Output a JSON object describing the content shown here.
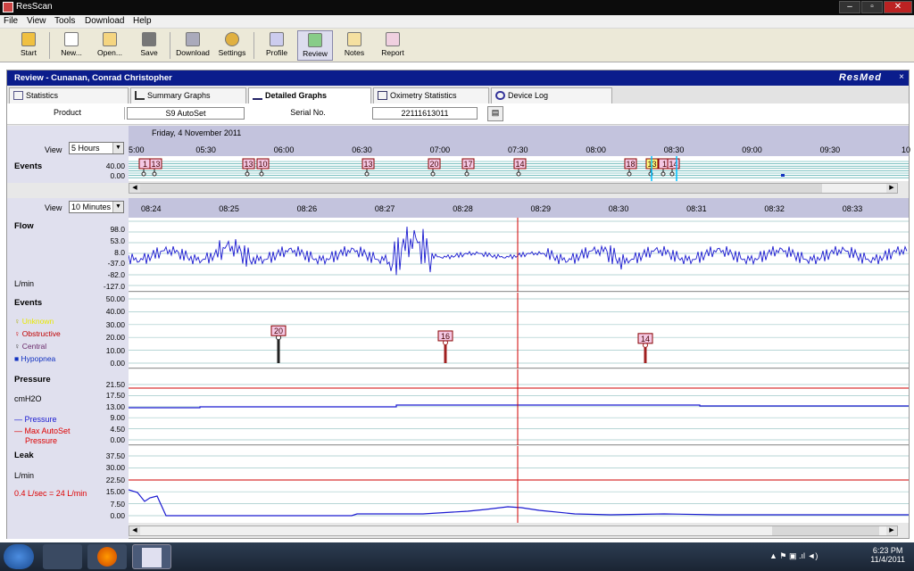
{
  "window": {
    "title": "ResScan"
  },
  "menu": [
    "File",
    "View",
    "Tools",
    "Download",
    "Help"
  ],
  "toolbar": [
    {
      "label": "Start",
      "icon": "start-icon"
    },
    {
      "label": "New...",
      "icon": "new-icon"
    },
    {
      "label": "Open...",
      "icon": "open-icon"
    },
    {
      "label": "Save",
      "icon": "save-icon"
    },
    {
      "label": "Download",
      "icon": "download-icon"
    },
    {
      "label": "Settings",
      "icon": "settings-icon"
    },
    {
      "label": "Profile",
      "icon": "profile-icon"
    },
    {
      "label": "Review",
      "icon": "review-icon"
    },
    {
      "label": "Notes",
      "icon": "notes-icon"
    },
    {
      "label": "Report",
      "icon": "report-icon"
    }
  ],
  "review": {
    "title": "Review - Cunanan, Conrad Christopher",
    "brand": "ResMed",
    "close": "×"
  },
  "tabs": [
    "Statistics",
    "Summary Graphs",
    "Detailed Graphs",
    "Oximetry Statistics",
    "Device Log"
  ],
  "product": {
    "product_label": "Product",
    "product_value": "S9 AutoSet",
    "serial_label": "Serial No.",
    "serial_value": "22111613011"
  },
  "overview": {
    "date": "Friday, 4 November 2011",
    "view_label": "View",
    "view_value": "5 Hours",
    "times": [
      "5:00",
      "05:30",
      "06:00",
      "06:30",
      "07:00",
      "07:30",
      "08:00",
      "08:30",
      "09:00",
      "09:30",
      "10"
    ],
    "events_title": "Events",
    "y_labels": [
      "40.00",
      "0.00"
    ],
    "badges": [
      "1",
      "13",
      "13",
      "10",
      "13",
      "20",
      "17",
      "14",
      "18",
      "13",
      "1",
      "14"
    ]
  },
  "detail": {
    "view_label": "View",
    "view_value": "10 Minutes",
    "times": [
      "08:24",
      "08:25",
      "08:26",
      "08:27",
      "08:28",
      "08:29",
      "08:30",
      "08:31",
      "08:32",
      "08:33"
    ]
  },
  "flow": {
    "title": "Flow",
    "unit": "L/min",
    "y_labels": [
      "98.0",
      "53.0",
      "8.0",
      "-37.0",
      "-82.0",
      "-127.0"
    ]
  },
  "events": {
    "title": "Events",
    "legend": [
      {
        "label": "Unknown",
        "color": "#e8e800"
      },
      {
        "label": "Obstructive",
        "color": "#c00000"
      },
      {
        "label": "Central",
        "color": "#6a2a6a"
      },
      {
        "label": "Hypopnea",
        "color": "#1030c0"
      }
    ],
    "y_labels": [
      "50.00",
      "40.00",
      "30.00",
      "20.00",
      "10.00",
      "0.00"
    ],
    "markers": [
      "20",
      "16",
      "14"
    ]
  },
  "pressure": {
    "title": "Pressure",
    "unit": "cmH2O",
    "legend_pressure": "Pressure",
    "legend_max": "Max AutoSet",
    "legend_max2": "Pressure",
    "y_labels": [
      "21.50",
      "17.50",
      "13.00",
      "9.00",
      "4.50",
      "0.00"
    ]
  },
  "leak": {
    "title": "Leak",
    "unit": "L/min",
    "note": "0.4 L/sec = 24 L/min",
    "y_labels": [
      "37.50",
      "30.00",
      "22.50",
      "15.00",
      "7.50",
      "0.00"
    ]
  },
  "taskbar": {
    "time": "6:23 PM",
    "date": "11/4/2011"
  },
  "colors": {
    "accent": "#0b1d8c",
    "plot_line": "#1a1ad0",
    "cursor": "#d00000"
  }
}
